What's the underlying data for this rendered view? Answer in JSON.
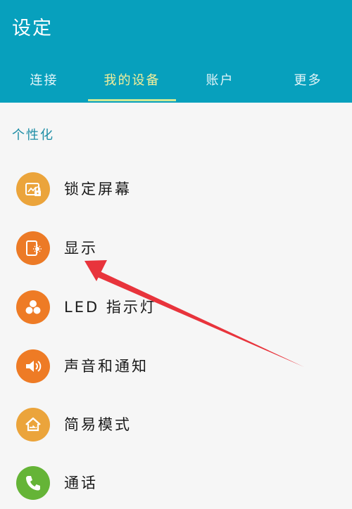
{
  "header": {
    "title": "设定"
  },
  "tabs": [
    {
      "label": "连接"
    },
    {
      "label": "我的设备"
    },
    {
      "label": "账户"
    },
    {
      "label": "更多"
    }
  ],
  "section": {
    "title": "个性化"
  },
  "items": [
    {
      "label": "锁定屏幕",
      "icon": "lock-screen-icon",
      "color": "#eba43b"
    },
    {
      "label": "显示",
      "icon": "display-icon",
      "color": "#ec7a26"
    },
    {
      "label": "LED 指示灯",
      "icon": "led-indicator-icon",
      "color": "#ee7b25"
    },
    {
      "label": "声音和通知",
      "icon": "sound-icon",
      "color": "#ee7b25"
    },
    {
      "label": "简易模式",
      "icon": "easy-mode-icon",
      "color": "#eba43b"
    },
    {
      "label": "通话",
      "icon": "phone-icon",
      "color": "#65b437"
    }
  ],
  "colors": {
    "header_bg": "#07a0bd",
    "active_tab_text": "#f3ef9a",
    "tab_underline": "#cfe894",
    "section_label": "#1f8ea6",
    "annotation_arrow": "#e8343c"
  }
}
